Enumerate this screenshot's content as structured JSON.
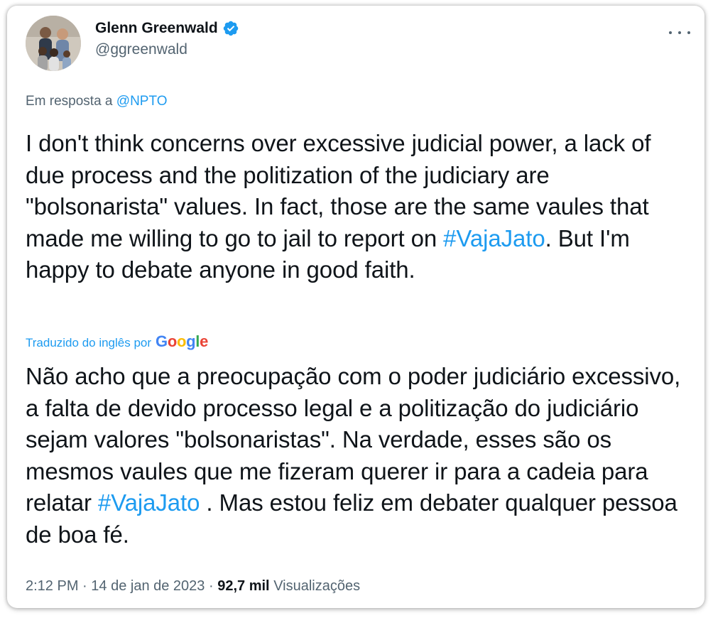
{
  "author": {
    "display_name": "Glenn Greenwald",
    "handle": "@ggreenwald",
    "verified": true
  },
  "reply": {
    "prefix": "Em resposta a",
    "mention": "@NPTO"
  },
  "tweet": {
    "text_1": "I don't think concerns over excessive judicial power, a lack of due process and the politization of the judiciary are \"bolsonarista\" values. In fact, those are the same vaules that made me willing to go to jail to report on ",
    "hashtag": "#VajaJato",
    "text_2": ". But I'm happy to debate anyone in good faith."
  },
  "translation": {
    "label": "Traduzido do inglês por",
    "provider_letters": [
      "G",
      "o",
      "o",
      "g",
      "l",
      "e"
    ],
    "provider_colors": [
      "#4285F4",
      "#EA4335",
      "#FBBC05",
      "#4285F4",
      "#34A853",
      "#EA4335"
    ],
    "text_1": "Não acho que a preocupação com o poder judiciário excessivo, a falta de devido processo legal e a politização do judiciário sejam valores \"bolsonaristas\". Na verdade, esses são os mesmos vaules que me fizeram querer ir para a cadeia para relatar ",
    "hashtag": "#VajaJato",
    "text_2": " . Mas estou feliz em debater qualquer pessoa de boa fé."
  },
  "meta": {
    "time": "2:12 PM",
    "separator": "·",
    "date": "14 de jan de 2023",
    "views_count": "92,7 mil",
    "views_label": "Visualizações"
  },
  "colors": {
    "accent": "#1d9bf0",
    "text": "#0f1419",
    "secondary": "#536471"
  },
  "icons": {
    "verified": "verified-badge-icon",
    "more": "more-horizontal-icon"
  }
}
